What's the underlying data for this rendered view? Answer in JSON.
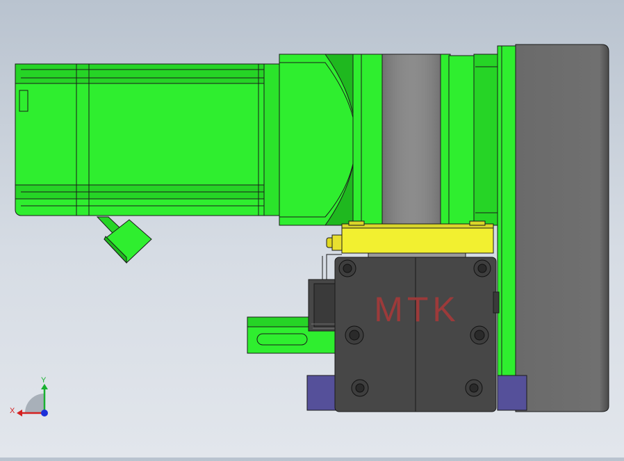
{
  "viewport": {
    "background_top": "#b9c3cf",
    "background_bottom": "#e2e6ec"
  },
  "model": {
    "logo_text": "MTK",
    "colors": {
      "motor_green": "#2fee2f",
      "green_dark": "#1fb81f",
      "green_shadow": "#18a818",
      "flange_gray": "#6e6e6e",
      "coupling_gray": "#8a8a8a",
      "rail_yellow": "#f2f030",
      "block_dark": "#474747",
      "end_plate_blue": "#55509a",
      "logo_red": "#9c3a3a",
      "outline": "#1a1a1a"
    }
  },
  "triad": {
    "x_label": "X",
    "y_label": "Y",
    "x_color": "#d42020",
    "y_color": "#18b030",
    "z_color": "#1c2fd8"
  }
}
